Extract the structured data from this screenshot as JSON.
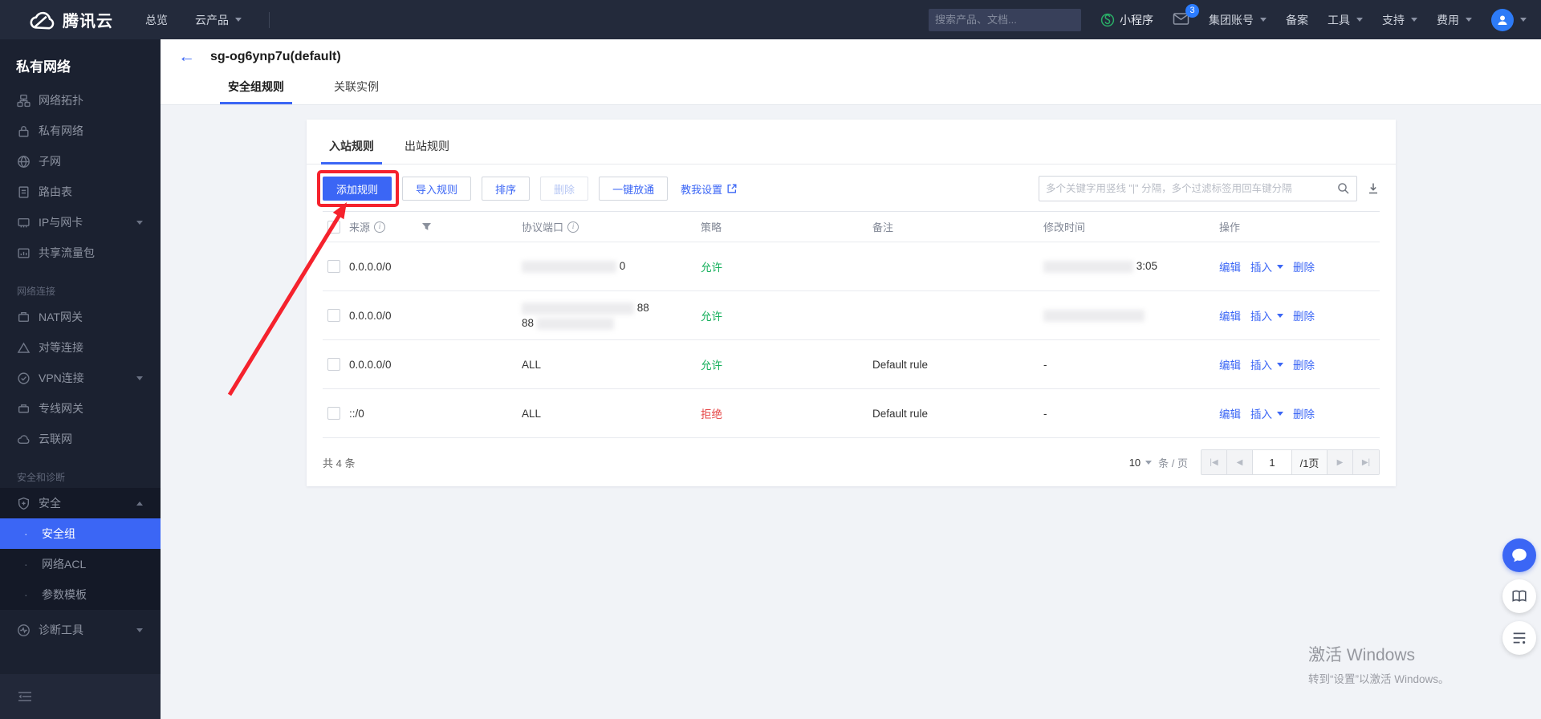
{
  "colors": {
    "primary": "#3b66f5",
    "allow": "#16b05c",
    "deny": "#e54545",
    "annotation": "#f5222d",
    "topbar_bg": "#232a3b",
    "sidebar_bg": "#1b2130"
  },
  "topbar": {
    "brand": "腾讯云",
    "nav_overview": "总览",
    "nav_products": "云产品",
    "search_placeholder": "搜索产品、文档...",
    "miniprogram": "小程序",
    "mail_badge": "3",
    "group_account": "集团账号",
    "beian": "备案",
    "tools": "工具",
    "support": "支持",
    "billing": "费用"
  },
  "sidebar": {
    "title": "私有网络",
    "items": [
      "网络拓扑",
      "私有网络",
      "子网",
      "路由表",
      "IP与网卡",
      "共享流量包"
    ],
    "net_section": "网络连接",
    "net_items": [
      "NAT网关",
      "对等连接",
      "VPN连接",
      "专线网关",
      "云联网"
    ],
    "sec_section": "安全和诊断",
    "security_label": "安全",
    "security_children": [
      "安全组",
      "网络ACL",
      "参数模板"
    ],
    "diag_label": "诊断工具"
  },
  "header": {
    "title": "sg-og6ynp7u(default)",
    "tabs": [
      "安全组规则",
      "关联实例"
    ]
  },
  "panel": {
    "tabs": [
      "入站规则",
      "出站规则"
    ],
    "buttons": {
      "add": "添加规则",
      "import": "导入规则",
      "sort": "排序",
      "delete": "删除",
      "open_all": "一键放通"
    },
    "help_link": "教我设置",
    "filter_placeholder": "多个关键字用竖线 \"|\" 分隔，多个过滤标签用回车键分隔",
    "table": {
      "headers": [
        "来源",
        "协议端口",
        "策略",
        "备注",
        "修改时间",
        "操作"
      ],
      "actions": [
        "编辑",
        "插入",
        "删除"
      ],
      "rows": [
        {
          "source": "0.0.0.0/0",
          "protocol_visible": "0",
          "policy": "允许",
          "note": "",
          "time_visible": "3:05"
        },
        {
          "source": "0.0.0.0/0",
          "protocol_visible": "88",
          "protocol_line2": "88",
          "policy": "允许",
          "note": "",
          "time_visible": ""
        },
        {
          "source": "0.0.0.0/0",
          "protocol": "ALL",
          "policy": "允许",
          "note": "Default rule",
          "time": "-"
        },
        {
          "source": "::/0",
          "protocol": "ALL",
          "policy": "拒绝",
          "note": "Default rule",
          "time": "-"
        }
      ]
    },
    "footer": {
      "total": "共 4 条",
      "page_size": "10",
      "per_page": "条 / 页",
      "page": "1",
      "page_total": "/1页"
    }
  },
  "watermark": {
    "line1": "激活 Windows",
    "line2": "转到“设置”以激活 Windows。"
  }
}
